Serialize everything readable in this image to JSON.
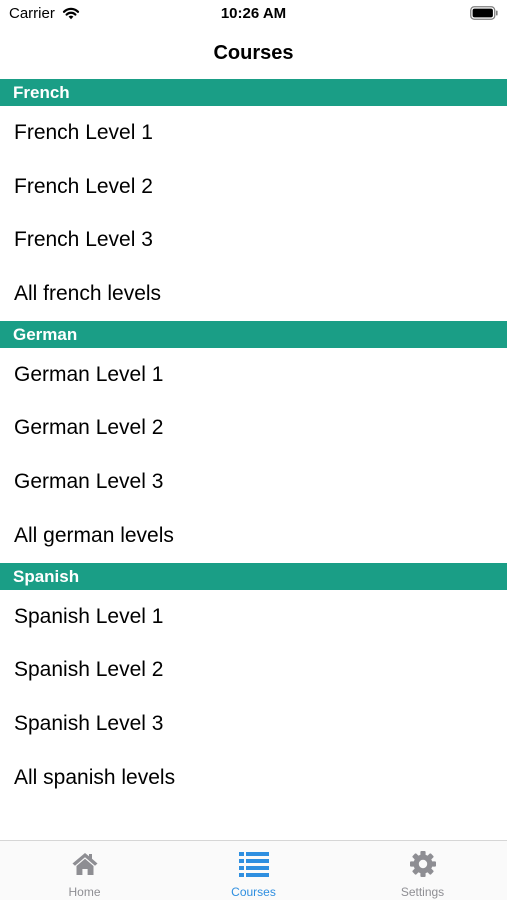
{
  "status_bar": {
    "carrier": "Carrier",
    "time": "10:26 AM",
    "wifi_icon": "wifi-icon",
    "battery_icon": "battery-icon"
  },
  "nav": {
    "title": "Courses"
  },
  "colors": {
    "section_header_bg": "#1a9e86",
    "tab_active": "#2f8fe0",
    "tab_inactive": "#8e8e93"
  },
  "sections": [
    {
      "header": "French",
      "items": [
        "French Level 1",
        "French Level 2",
        "French Level 3",
        "All french levels"
      ]
    },
    {
      "header": "German",
      "items": [
        "German Level 1",
        "German Level 2",
        "German Level 3",
        "All german levels"
      ]
    },
    {
      "header": "Spanish",
      "items": [
        "Spanish Level 1",
        "Spanish Level 2",
        "Spanish Level 3",
        "All spanish levels"
      ]
    }
  ],
  "tab_bar": {
    "tabs": [
      {
        "label": "Home",
        "icon": "home-icon",
        "active": false
      },
      {
        "label": "Courses",
        "icon": "list-icon",
        "active": true
      },
      {
        "label": "Settings",
        "icon": "gear-icon",
        "active": false
      }
    ]
  }
}
